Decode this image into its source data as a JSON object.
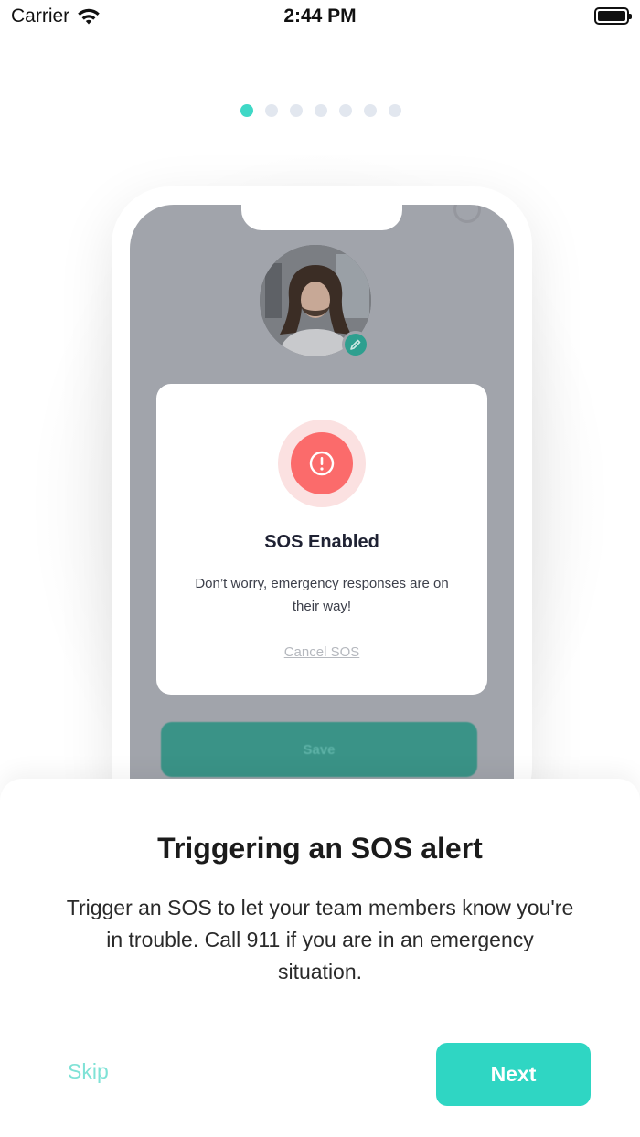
{
  "status_bar": {
    "carrier": "Carrier",
    "time": "2:44 PM",
    "icons": [
      "wifi-icon",
      "battery-icon"
    ]
  },
  "pager": {
    "total": 7,
    "current": 1,
    "active_color": "#3fd8c6",
    "inactive_color": "#e2e7ef"
  },
  "illustration": {
    "sos_card": {
      "icon": "alert-icon",
      "title": "SOS Enabled",
      "description": "Don’t worry, emergency responses are on their way!",
      "cancel_label": "Cancel SOS"
    },
    "save_label": "Save",
    "avatar_icon": "profile-photo",
    "edit_icon": "pencil-icon"
  },
  "onboarding": {
    "title": "Triggering an SOS alert",
    "body": "Trigger an SOS to let your team members know you're in trouble. Call 911 if you are in an emergency situation.",
    "skip_label": "Skip",
    "next_label": "Next"
  },
  "colors": {
    "accent": "#2fd6c3",
    "sos_red": "#fb6b6b",
    "skip_text": "#7fe2d6"
  }
}
